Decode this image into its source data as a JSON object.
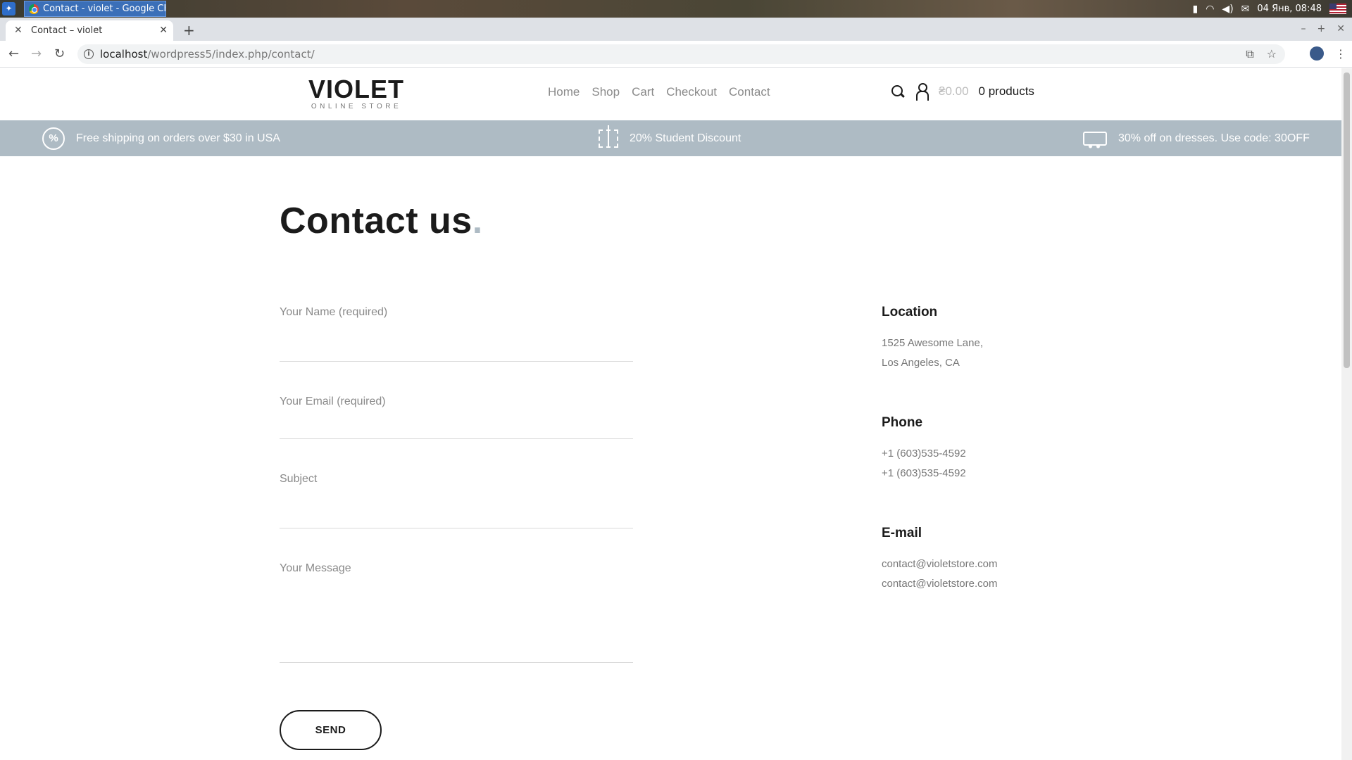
{
  "os": {
    "task_title": "Contact - violet - Google Chr...",
    "clock": "04 Янв, 08:48"
  },
  "browser": {
    "tab_title": "Contact – violet",
    "url_host": "localhost",
    "url_path": "/wordpress5/index.php/contact/"
  },
  "site": {
    "logo": "VIOLET",
    "logo_sub": "ONLINE STORE",
    "nav": [
      "Home",
      "Shop",
      "Cart",
      "Checkout",
      "Contact"
    ],
    "cart_total": "₴0.00",
    "cart_count": "0 products"
  },
  "promo": [
    {
      "text": "Free shipping on orders over $30 in USA",
      "icon": "percent-badge-icon"
    },
    {
      "text": "20% Student Discount",
      "icon": "gift-icon"
    },
    {
      "text": "30% off on dresses. Use code: 30OFF",
      "icon": "truck-icon"
    }
  ],
  "page": {
    "title": "Contact us",
    "title_dot": "."
  },
  "form": {
    "name_label": "Your Name (required)",
    "email_label": "Your Email (required)",
    "subject_label": "Subject",
    "message_label": "Your Message",
    "send_label": "SEND"
  },
  "contact_info": {
    "location_heading": "Location",
    "location_lines": [
      "1525 Awesome Lane,",
      "Los Angeles, CA"
    ],
    "phone_heading": "Phone",
    "phone_lines": [
      "+1 (603)535-4592",
      "+1 (603)535-4592"
    ],
    "email_heading": "E-mail",
    "email_lines": [
      "contact@violetstore.com",
      "contact@violetstore.com"
    ]
  },
  "colors": {
    "promo_bg": "#aebbc4",
    "text_dark": "#1b1b1b",
    "nav_gray": "#8a8a8a"
  }
}
